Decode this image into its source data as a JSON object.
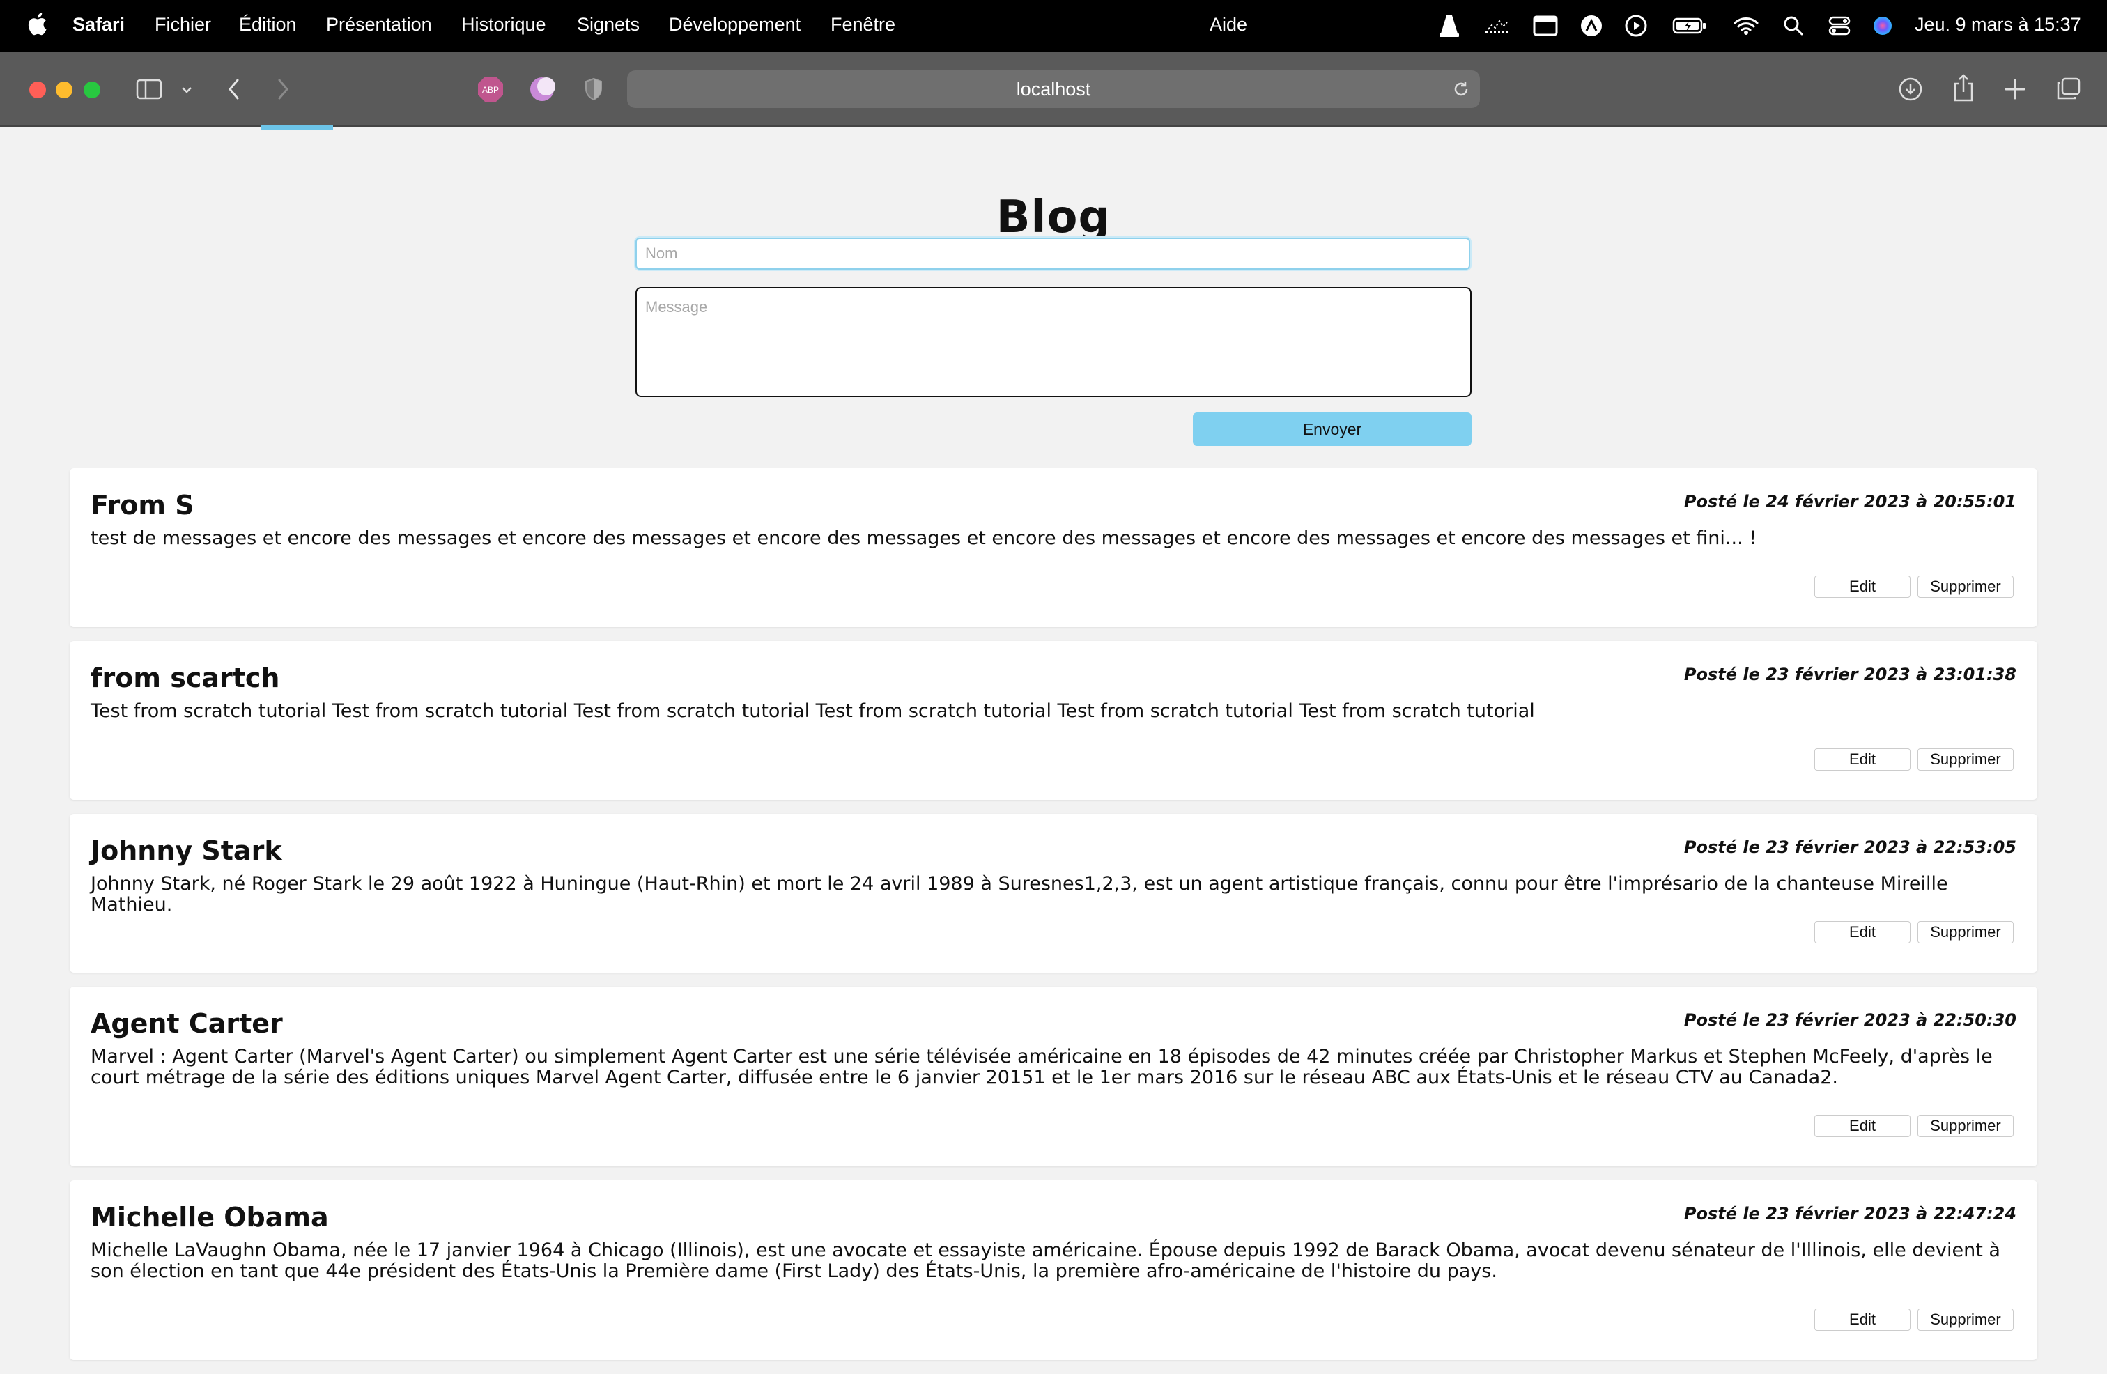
{
  "menubar": {
    "app_name": "Safari",
    "items": [
      "Fichier",
      "Édition",
      "Présentation",
      "Historique",
      "Signets",
      "Développement",
      "Fenêtre"
    ],
    "help": "Aide",
    "clock": "Jeu. 9 mars à 15:37"
  },
  "browser": {
    "url": "localhost",
    "abp_label": "ABP"
  },
  "page": {
    "title": "Blog",
    "name_placeholder": "Nom",
    "message_placeholder": "Message",
    "send_label": "Envoyer",
    "edit_label": "Edit",
    "delete_label": "Supprimer"
  },
  "posts": [
    {
      "author": "From S",
      "date": "Posté le 24 février 2023 à 20:55:01",
      "message": "test de messages et encore des messages et encore des messages et encore des messages et encore des messages et encore des messages et encore des messages et fini... !"
    },
    {
      "author": "from scartch",
      "date": "Posté le 23 février 2023 à 23:01:38",
      "message": "Test from scratch tutorial Test from scratch tutorial Test from scratch tutorial Test from scratch tutorial Test from scratch tutorial Test from scratch tutorial"
    },
    {
      "author": "Johnny Stark",
      "date": "Posté le 23 février 2023 à 22:53:05",
      "message": "Johnny Stark, né Roger Stark le 29 août 1922 à Huningue (Haut-Rhin) et mort le 24 avril 1989 à Suresnes1,2,3, est un agent artistique français, connu pour être l'imprésario de la chanteuse Mireille Mathieu."
    },
    {
      "author": "Agent Carter",
      "date": "Posté le 23 février 2023 à 22:50:30",
      "message": "Marvel : Agent Carter (Marvel's Agent Carter) ou simplement Agent Carter est une série télévisée américaine en 18 épisodes de 42 minutes créée par Christopher Markus et Stephen McFeely, d'après le court métrage de la série des éditions uniques Marvel Agent Carter, diffusée entre le 6 janvier 20151 et le 1er mars 2016 sur le réseau ABC aux États-Unis et le réseau CTV au Canada2."
    },
    {
      "author": "Michelle Obama",
      "date": "Posté le 23 février 2023 à 22:47:24",
      "message": "Michelle LaVaughn Obama, née le 17 janvier 1964 à Chicago (Illinois), est une avocate et essayiste américaine. Épouse depuis 1992 de Barack Obama, avocat devenu sénateur de l'Illinois, elle devient à son élection en tant que 44e président des États-Unis la Première dame (First Lady) des États-Unis, la première afro-américaine de l'histoire du pays."
    }
  ]
}
